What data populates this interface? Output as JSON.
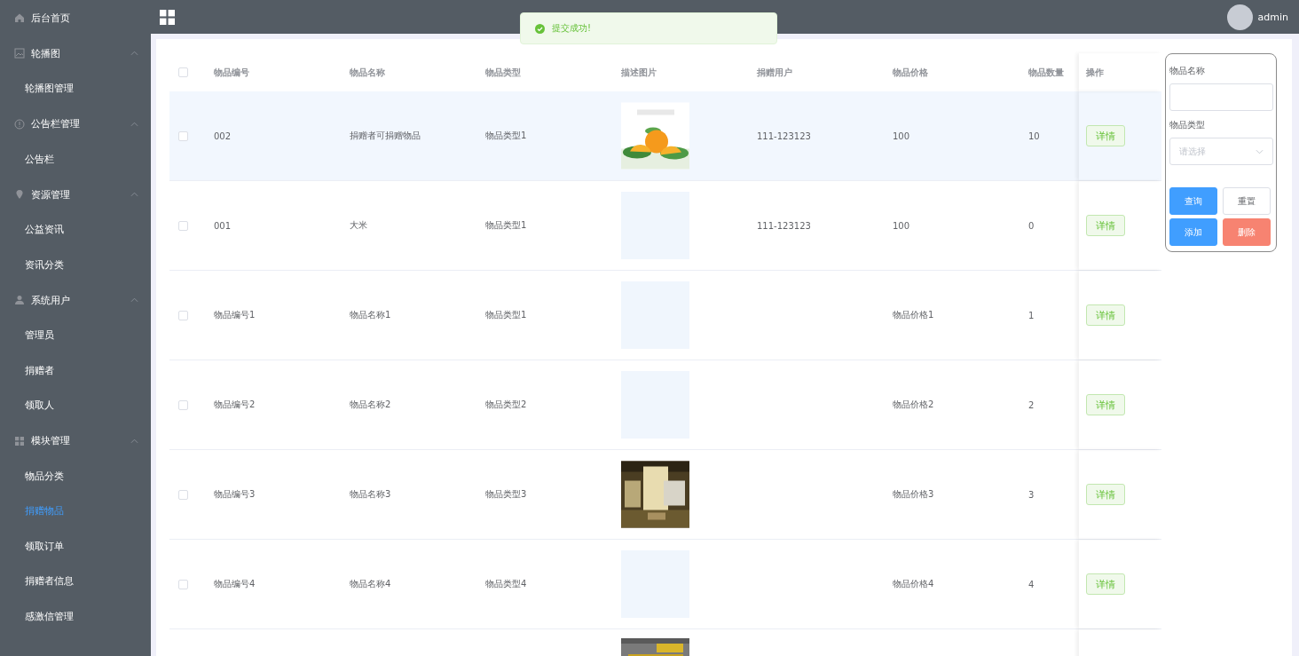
{
  "sidebar": {
    "items": [
      {
        "label": "后台首页"
      },
      {
        "label": "轮播图",
        "expanded": true,
        "children": [
          {
            "label": "轮播图管理",
            "selected": false
          }
        ]
      },
      {
        "label": "公告栏管理",
        "expanded": true,
        "children": [
          {
            "label": "公告栏",
            "selected": false
          }
        ]
      },
      {
        "label": "资源管理",
        "expanded": true,
        "children": [
          {
            "label": "公益资讯",
            "selected": false
          },
          {
            "label": "资讯分类",
            "selected": false
          }
        ]
      },
      {
        "label": "系统用户",
        "expanded": true,
        "children": [
          {
            "label": "管理员",
            "selected": false
          },
          {
            "label": "捐赠者",
            "selected": false
          },
          {
            "label": "领取人",
            "selected": false
          }
        ]
      },
      {
        "label": "模块管理",
        "expanded": true,
        "children": [
          {
            "label": "物品分类",
            "selected": false
          },
          {
            "label": "捐赠物品",
            "selected": true
          },
          {
            "label": "领取订单",
            "selected": false
          },
          {
            "label": "捐赠者信息",
            "selected": false
          },
          {
            "label": "感激信管理",
            "selected": false
          }
        ]
      }
    ]
  },
  "header": {
    "user": "admin"
  },
  "toast": {
    "message": "提交成功!"
  },
  "table": {
    "columns": [
      "物品编号",
      "物品名称",
      "物品类型",
      "描述图片",
      "捐赠用户",
      "物品价格",
      "物品数量",
      "操作"
    ],
    "select_all": {
      "checked": false
    },
    "rows": [
      {
        "hover": true,
        "checked": false,
        "code": "002",
        "name": "捐赠者可捐赠物品",
        "type": "物品类型1",
        "user": "111-123123",
        "price": "100",
        "quantity": "10",
        "action": "详情"
      },
      {
        "hover": false,
        "checked": false,
        "code": "001",
        "name": "大米",
        "type": "物品类型1",
        "user": "111-123123",
        "price": "100",
        "quantity": "0",
        "action": "详情"
      },
      {
        "hover": false,
        "checked": false,
        "code": "物品编号1",
        "name": "物品名称1",
        "type": "物品类型1",
        "price": "物品价格1",
        "quantity": "1",
        "action": "详情"
      },
      {
        "hover": false,
        "checked": false,
        "code": "物品编号2",
        "name": "物品名称2",
        "type": "物品类型2",
        "price": "物品价格2",
        "quantity": "2",
        "action": "详情"
      },
      {
        "hover": false,
        "checked": false,
        "code": "物品编号3",
        "name": "物品名称3",
        "type": "物品类型3",
        "price": "物品价格3",
        "quantity": "3",
        "action": "详情"
      },
      {
        "hover": false,
        "checked": false,
        "code": "物品编号4",
        "name": "物品名称4",
        "type": "物品类型4",
        "price": "物品价格4",
        "quantity": "4",
        "action": "详情"
      },
      {
        "hover": false
      }
    ]
  },
  "search": {
    "fields": [
      {
        "label": "物品名称",
        "kind": "input"
      },
      {
        "label": "物品类型",
        "kind": "select",
        "placeholder": "请选择"
      }
    ],
    "buttons": [
      {
        "label": "查询",
        "kind": "primary"
      },
      {
        "label": "重置",
        "kind": "default"
      },
      {
        "label": "添加",
        "kind": "primary"
      },
      {
        "label": "删除",
        "kind": "danger"
      }
    ]
  }
}
